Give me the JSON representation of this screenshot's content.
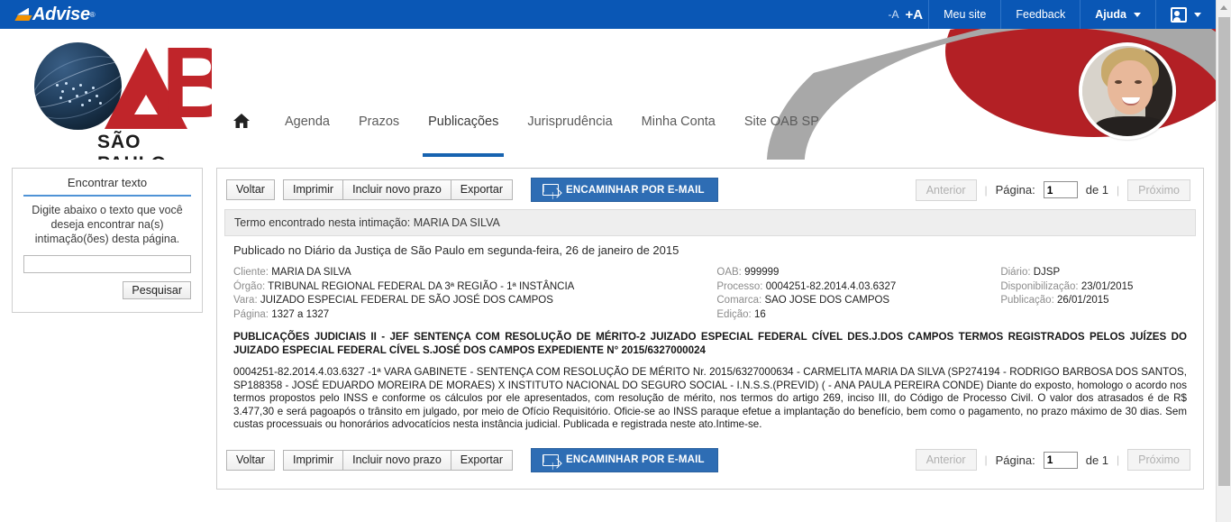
{
  "brand": {
    "name": "Advise",
    "registered": "®"
  },
  "topbar": {
    "font_decrease": "-A",
    "font_increase": "+A",
    "items": [
      {
        "label": "Meu site"
      },
      {
        "label": "Feedback"
      },
      {
        "label": "Ajuda",
        "caret": "▾"
      }
    ],
    "user_menu_caret": "▾"
  },
  "logo": {
    "letter_b": "B",
    "subtitle": "SÃO PAULO"
  },
  "mainnav": {
    "home_icon": "⌂",
    "items": [
      {
        "label": "Agenda",
        "active": false
      },
      {
        "label": "Prazos",
        "active": false
      },
      {
        "label": "Publicações",
        "active": true
      },
      {
        "label": "Jurisprudência",
        "active": false
      },
      {
        "label": "Minha Conta",
        "active": false
      },
      {
        "label": "Site OAB SP",
        "active": false
      }
    ]
  },
  "sidebar": {
    "title": "Encontrar texto",
    "description": "Digite abaixo o texto que você deseja encontrar na(s) intimação(ões) desta página.",
    "input_value": "",
    "input_placeholder": "",
    "search_button": "Pesquisar"
  },
  "toolbar": {
    "back": "Voltar",
    "print": "Imprimir",
    "new_deadline": "Incluir novo prazo",
    "export": "Exportar",
    "forward_email": "ENCAMINHAR POR E-MAIL"
  },
  "pager": {
    "previous": "Anterior",
    "separator": "|",
    "page_label": "Página:",
    "page_value": "1",
    "of_label": "de 1",
    "next": "Próximo"
  },
  "publication": {
    "term_found": "Termo encontrado nesta intimação: MARIA DA SILVA",
    "published_line": "Publicado no Diário da Justiça de São Paulo em segunda-feira, 26 de janeiro de 2015",
    "meta_col1": [
      {
        "label": "Cliente:",
        "value": "MARIA DA SILVA"
      },
      {
        "label": "Órgão:",
        "value": "TRIBUNAL REGIONAL FEDERAL DA 3ª REGIÃO - 1ª INSTÂNCIA"
      },
      {
        "label": "Vara:",
        "value": "JUIZADO ESPECIAL FEDERAL DE SÃO JOSÉ DOS CAMPOS"
      },
      {
        "label": "Página:",
        "value": "1327 a 1327"
      }
    ],
    "meta_col2": [
      {
        "label": "OAB:",
        "value": "999999"
      },
      {
        "label": "Processo:",
        "value": "0004251-82.2014.4.03.6327"
      },
      {
        "label": "Comarca:",
        "value": "SAO JOSE DOS CAMPOS"
      },
      {
        "label": "Edição:",
        "value": "16"
      }
    ],
    "meta_col3": [
      {
        "label": "Diário:",
        "value": "DJSP"
      },
      {
        "label": "Disponibilização:",
        "value": "23/01/2015"
      },
      {
        "label": "Publicação:",
        "value": "26/01/2015"
      }
    ],
    "headline": "PUBLICAÇÕES JUDICIAIS II - JEF SENTENÇA COM RESOLUÇÃO DE MÉRITO-2 JUIZADO ESPECIAL FEDERAL CÍVEL DES.J.DOS CAMPOS TERMOS REGISTRADOS PELOS JUÍZES DO JUIZADO ESPECIAL FEDERAL CÍVEL S.JOSÉ DOS CAMPOS EXPEDIENTE N° 2015/6327000024",
    "body": "0004251-82.2014.4.03.6327 -1ª VARA GABINETE - SENTENÇA COM RESOLUÇÃO DE MÉRITO Nr. 2015/6327000634 - CARMELITA MARIA DA SILVA (SP274194 - RODRIGO BARBOSA DOS SANTOS, SP188358 - JOSÉ EDUARDO MOREIRA DE MORAES) X INSTITUTO NACIONAL DO SEGURO SOCIAL - I.N.S.S.(PREVID) ( - ANA PAULA PEREIRA CONDE) Diante do exposto, homologo o acordo nos termos propostos pelo INSS e conforme os cálculos por ele apresentados, com resolução de mérito, nos termos do artigo 269, inciso III, do Código de Processo Civil. O valor dos atrasados é de R$ 3.477,30 e será pagoapós o trânsito em julgado, por meio de Ofício Requisitório. Oficie-se ao INSS paraque efetue a implantação do benefício, bem como o pagamento, no prazo máximo de 30 dias. Sem custas processuais ou honorários advocatícios nesta instância judicial. Publicada e registrada neste ato.Intime-se."
  },
  "colors": {
    "topbar_blue": "#0a57b5",
    "accent_blue": "#1763b0",
    "mail_button": "#2e6db4",
    "oab_red": "#c0252a",
    "swoosh_gray": "#a8a8a8"
  }
}
